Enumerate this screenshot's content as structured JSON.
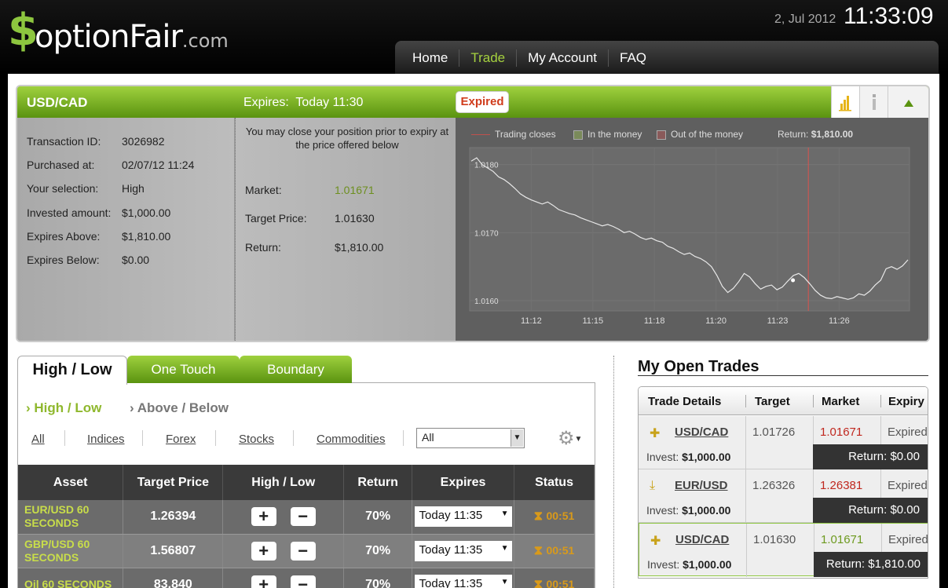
{
  "header": {
    "logo_s": "$",
    "logo_text": "optionFair",
    "logo_domain": ".com",
    "date": "2, Jul 2012",
    "time": "11:33:09",
    "nav": [
      "Home",
      "Trade",
      "My Account",
      "FAQ"
    ]
  },
  "position": {
    "symbol": "USD/CAD",
    "expires_label": "Expires:",
    "expires_value": "Today 11:30",
    "status_badge": "Expired",
    "details": [
      {
        "label": "Transaction ID:",
        "value": "3026982"
      },
      {
        "label": "Purchased at:",
        "value": "02/07/12 11:24"
      },
      {
        "label": "Your selection:",
        "value": "High"
      },
      {
        "label": "Invested amount:",
        "value": "$1,000.00"
      },
      {
        "label": "Expires Above:",
        "value": "$1,810.00"
      },
      {
        "label": "Expires Below:",
        "value": "$0.00"
      }
    ],
    "close_note": "You may close your position prior to expiry at the price offered below",
    "market_label": "Market:",
    "market_value": "1.01671",
    "target_label": "Target Price:",
    "target_value": "1.01630",
    "return_label": "Return:",
    "return_value": "$1,810.00",
    "market_color": "#6d8f1f"
  },
  "chart_data": {
    "type": "line",
    "legend": {
      "trading_closes": "Trading closes",
      "in_money": "In the money",
      "out_money": "Out of the money",
      "return_prefix": "Return:",
      "return_value": "$1,810.00"
    },
    "x_ticks": [
      "11:12",
      "11:15",
      "11:18",
      "11:20",
      "11:23",
      "11:26"
    ],
    "y_ticks": [
      "1.0180",
      "1.0170",
      "1.0160"
    ],
    "ylim": [
      1.01585,
      1.01825
    ],
    "trading_close_x": 0.77,
    "series": [
      {
        "values": [
          1.01805,
          1.0181,
          1.018,
          1.01795,
          1.0179,
          1.01782,
          1.01778,
          1.01772,
          1.01765,
          1.01757,
          1.01752,
          1.01748,
          1.01745,
          1.01742,
          1.01745,
          1.0174,
          1.01734,
          1.01731,
          1.01728,
          1.01726,
          1.01722,
          1.01719,
          1.01716,
          1.01713,
          1.0171,
          1.01712,
          1.01709,
          1.01705,
          1.017,
          1.01702,
          1.01698,
          1.01693,
          1.0169,
          1.01692,
          1.01688,
          1.01686,
          1.0168,
          1.01677,
          1.01672,
          1.01668,
          1.0167,
          1.01665,
          1.01662,
          1.01657,
          1.0165,
          1.01637,
          1.01621,
          1.01612,
          1.01618,
          1.01628,
          1.0164,
          1.01635,
          1.01625,
          1.01617,
          1.01621,
          1.01623,
          1.01616,
          1.0162,
          1.01629,
          1.01637,
          1.0164,
          1.01634,
          1.01625,
          1.01615,
          1.01608,
          1.01604,
          1.01603,
          1.01606,
          1.01604,
          1.01602,
          1.01604,
          1.0161,
          1.01608,
          1.01614,
          1.01623,
          1.0163,
          1.01647,
          1.0165,
          1.01646,
          1.01651,
          1.0166
        ]
      }
    ]
  },
  "tabs": [
    "High / Low",
    "One Touch",
    "Boundary"
  ],
  "subtabs": [
    "High / Low",
    "Above / Below"
  ],
  "filters": [
    "All",
    "Indices",
    "Forex",
    "Stocks",
    "Commodities"
  ],
  "filter_select": "All",
  "table": {
    "headers": [
      "Asset",
      "Target Price",
      "High / Low",
      "Return",
      "Expires",
      "Status"
    ],
    "rows": [
      {
        "asset": "EUR/USD 60 SECONDS",
        "price": "1.26394",
        "ret": "70%",
        "expires": "Today 11:35",
        "status": "00:51"
      },
      {
        "asset": "GBP/USD 60 SECONDS",
        "price": "1.56807",
        "ret": "70%",
        "expires": "Today 11:35",
        "status": "00:51"
      },
      {
        "asset": "Oil 60 SECONDS",
        "price": "83.840",
        "ret": "70%",
        "expires": "Today 11:35",
        "status": "00:51"
      }
    ]
  },
  "open_trades": {
    "title": "My Open Trades",
    "headers": [
      "Trade Details",
      "Target",
      "Market",
      "Expiry"
    ],
    "invest_label": "Invest:",
    "rows": [
      {
        "pair": "USD/CAD",
        "invest": "$1,000.00",
        "target": "1.01726",
        "market": "1.01671",
        "market_color": "#c0281f",
        "expiry": "Expired",
        "return": "Return: $0.00"
      },
      {
        "pair": "EUR/USD",
        "invest": "$1,000.00",
        "target": "1.26326",
        "market": "1.26381",
        "market_color": "#c0281f",
        "expiry": "Expired",
        "return": "Return: $0.00"
      },
      {
        "pair": "USD/CAD",
        "invest": "$1,000.00",
        "target": "1.01630",
        "market": "1.01671",
        "market_color": "#6d9a1f",
        "expiry": "Expired",
        "return": "Return: $1,810.00"
      }
    ]
  }
}
